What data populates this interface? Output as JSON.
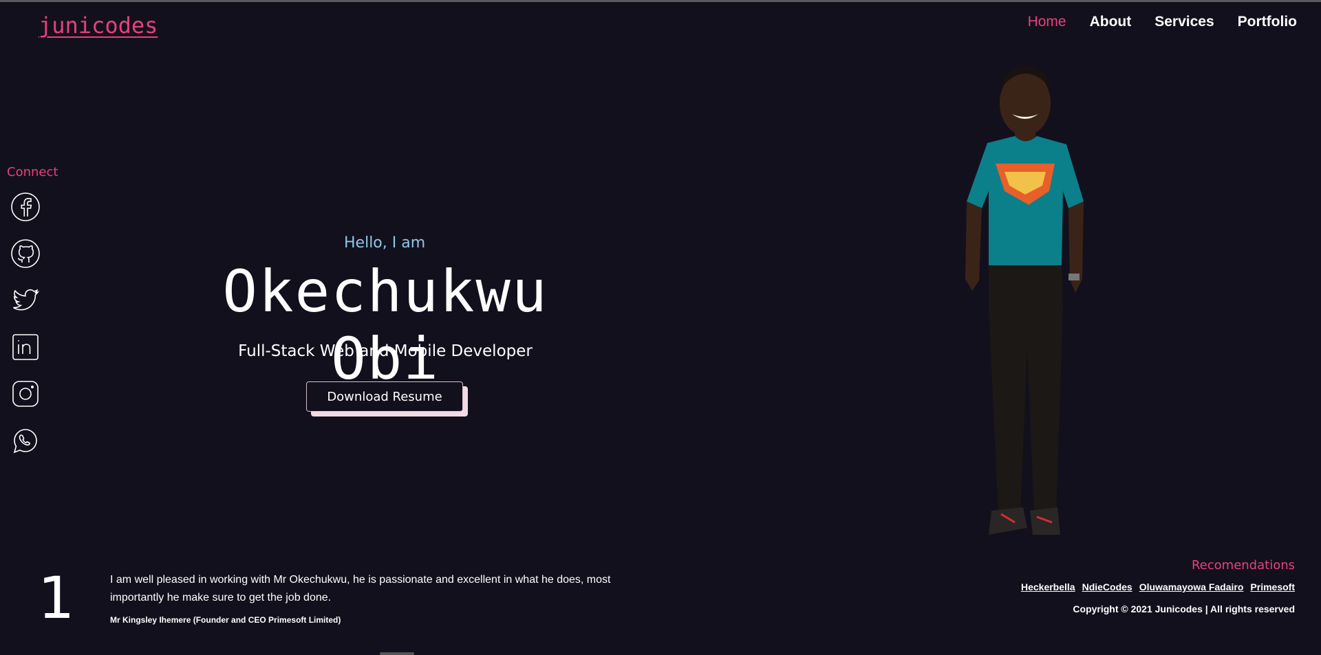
{
  "logo": {
    "text": "junicodes"
  },
  "nav": {
    "items": [
      {
        "label": "Home",
        "active": true
      },
      {
        "label": "About",
        "active": false
      },
      {
        "label": "Services",
        "active": false
      },
      {
        "label": "Portfolio",
        "active": false
      }
    ]
  },
  "connect": {
    "title": "Connect",
    "icons": [
      "facebook-icon",
      "github-icon",
      "twitter-icon",
      "linkedin-icon",
      "instagram-icon",
      "whatsapp-icon"
    ]
  },
  "hero": {
    "greeting": "Hello, I am",
    "name": "Okechukwu Obi",
    "role": "Full-Stack Web and Mobile Developer",
    "button": "Download Resume"
  },
  "testimonial": {
    "number": "1",
    "quote": "I am well pleased in working with Mr Okechukwu, he is passionate and excellent in what he does, most importantly he make sure to get the job done.",
    "author": "Mr Kingsley Ihemere (Founder and CEO Primesoft Limited)"
  },
  "footer": {
    "rec_title": "Recomendations",
    "links": [
      "Heckerbella",
      "NdieCodes",
      "Oluwamayowa Fadairo",
      "Primesoft"
    ],
    "copyright": "Copyright © 2021 Junicodes | All rights reserved"
  },
  "colors": {
    "background": "#13101d",
    "accent": "#e8407e",
    "greeting": "#8ec7e8"
  }
}
